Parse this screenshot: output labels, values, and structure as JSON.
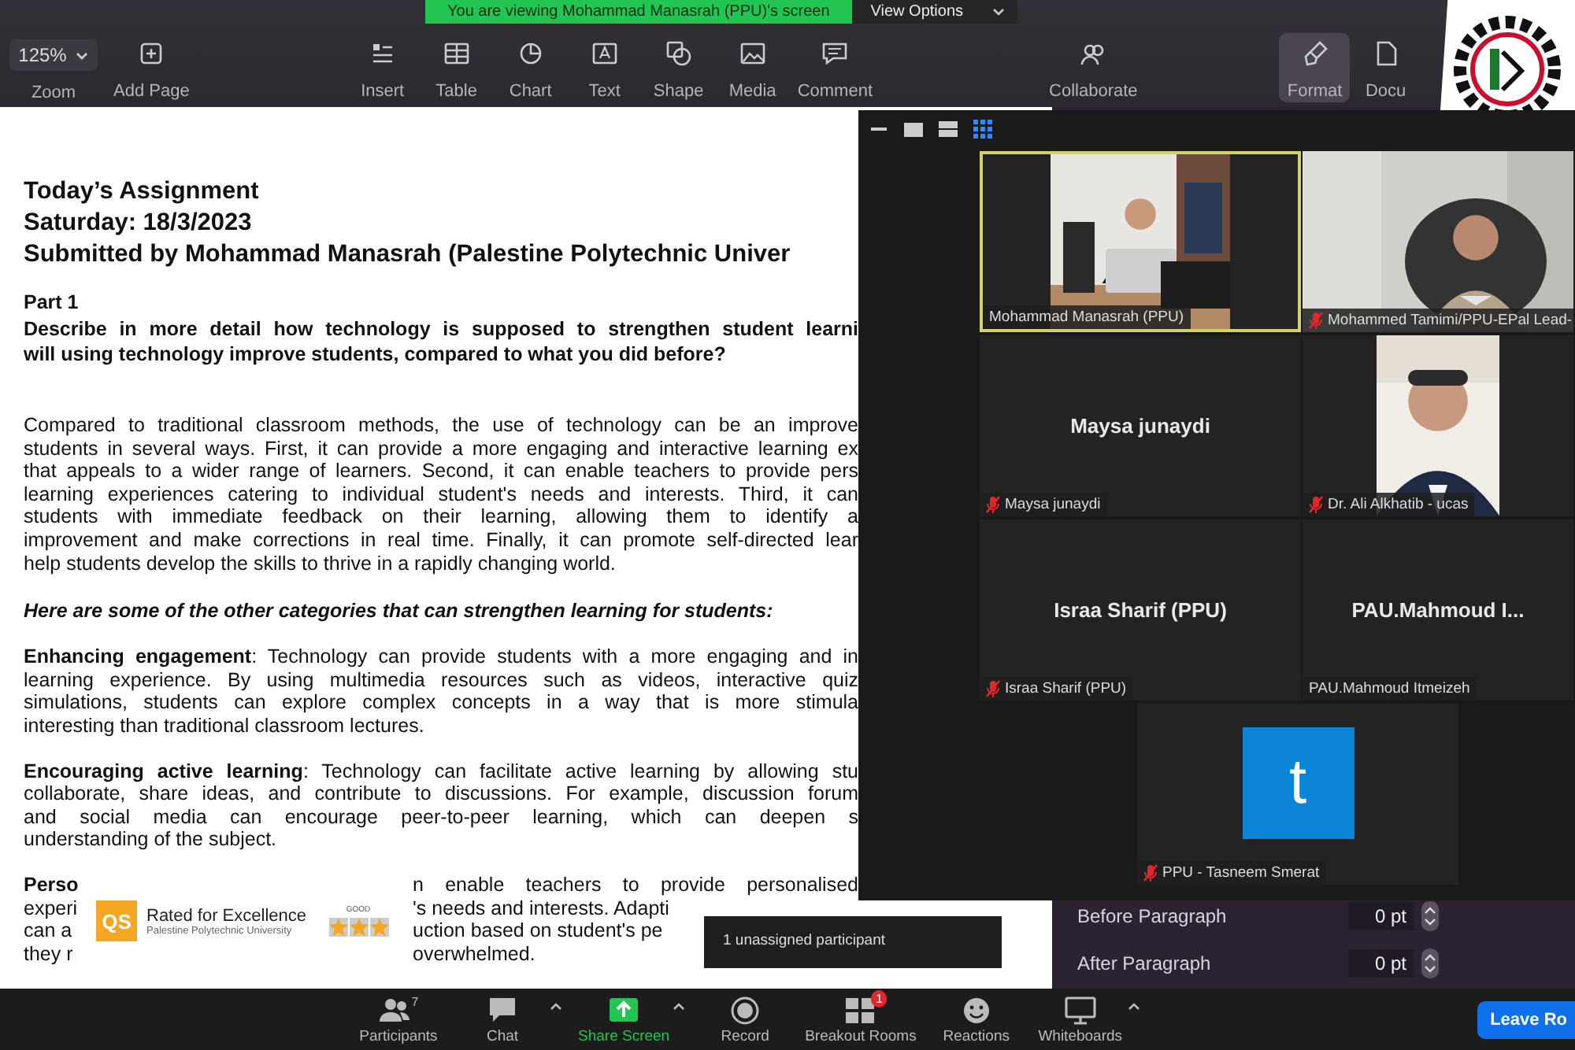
{
  "banner": {
    "message": "You are viewing Mohammad Manasrah (PPU)'s screen",
    "options": "View Options"
  },
  "toolbar": {
    "zoom": {
      "value": "125%",
      "label": "Zoom"
    },
    "groups": [
      [
        {
          "label": "Add Page",
          "selected": false
        }
      ],
      [
        {
          "label": "Insert",
          "selected": false
        },
        {
          "label": "Table",
          "selected": false
        },
        {
          "label": "Chart",
          "selected": false
        },
        {
          "label": "Text",
          "selected": false
        },
        {
          "label": "Shape",
          "selected": false
        },
        {
          "label": "Media",
          "selected": false
        },
        {
          "label": "Comment",
          "selected": false
        }
      ],
      [
        {
          "label": "Collaborate",
          "selected": false
        }
      ],
      [
        {
          "label": "Format",
          "selected": true
        },
        {
          "label": "Docu",
          "selected": false
        }
      ]
    ]
  },
  "document": {
    "blocks": [
      {
        "kind": "title",
        "lines": [
          "Today’s Assignment",
          "Saturday: 18/3/2023",
          "Submitted by Mohammad Manasrah (Palestine Polytechnic Univer"
        ]
      },
      {
        "kind": "part",
        "lines": [
          "Part 1"
        ]
      },
      {
        "kind": "question",
        "lines": [
          {
            "text": "Describe in more detail how technology is supposed to strengthen student learni",
            "justified": true
          },
          {
            "text": "will using technology improve students, compared to what you did before?",
            "justified": false
          }
        ]
      },
      {
        "kind": "paragraph",
        "lines": [
          {
            "text": "Compared to traditional classroom methods, the use of technology can be an improve",
            "justified": true
          },
          {
            "text": "students in several ways. First, it can provide a more engaging and interactive learning ex",
            "justified": true
          },
          {
            "text": "that appeals to a wider range of learners. Second, it can enable teachers to provide pers",
            "justified": true
          },
          {
            "text": "learning experiences catering to individual student's needs and interests. Third, it can",
            "justified": true
          },
          {
            "text": "students with immediate feedback on their learning, allowing them to identify a",
            "justified": true
          },
          {
            "text": "improvement and make corrections in real time. Finally, it can promote self-directed lear",
            "justified": true
          },
          {
            "text": "help students develop the skills to thrive in a rapidly changing world.",
            "justified": false
          }
        ]
      },
      {
        "kind": "lead",
        "lines": [
          "Here are some of the other categories that can strengthen learning for students:"
        ]
      },
      {
        "kind": "paragraph",
        "lines": [
          {
            "text": "**Enhancing engagement**: Technology can provide students with a more engaging and in",
            "justified": true
          },
          {
            "text": "learning experience. By using multimedia resources such as videos, interactive quiz",
            "justified": true
          },
          {
            "text": "simulations, students can explore complex concepts in a way that is more stimula",
            "justified": true
          },
          {
            "text": "interesting than traditional classroom lectures.",
            "justified": false
          }
        ]
      },
      {
        "kind": "paragraph",
        "lines": [
          {
            "text": "**Encouraging active learning**: Technology can facilitate active learning by allowing stu",
            "justified": true
          },
          {
            "text": "collaborate, share ideas, and contribute to discussions. For example, discussion forum",
            "justified": true
          },
          {
            "text": "and social media can encourage peer-to-peer learning, which can deepen s",
            "justified": true
          },
          {
            "text": "understanding of the subject.",
            "justified": false
          }
        ]
      },
      {
        "kind": "split",
        "lines": [
          {
            "left": "**Perso**",
            "right": "n enable teachers to provide personalised",
            "justified": true
          },
          {
            "left": "experi",
            "right": "'s needs and interests. Adapti",
            "justified": false
          },
          {
            "left": "can a",
            "right": "uction based on student's pe",
            "justified": false
          },
          {
            "left": "they r",
            "right": "overwhelmed.",
            "justified": false
          }
        ]
      }
    ]
  },
  "badge": {
    "logo": "QS",
    "title": "Rated for Excellence",
    "subtitle": "Palestine Polytechnic University",
    "rating_label": "GOOD",
    "stars": 3
  },
  "gallery": {
    "views": [
      {
        "selected": false
      },
      {
        "selected": false
      },
      {
        "selected": false
      },
      {
        "selected": true
      }
    ],
    "tiles": [
      {
        "kind": "video",
        "label": "Mohammad Manasrah (PPU)",
        "muted": false,
        "selected": true
      },
      {
        "kind": "video",
        "label": "Mohammed Tamimi/PPU-EPal Lead-",
        "muted": true,
        "selected": false
      },
      {
        "kind": "name",
        "name": "Maysa junaydi",
        "label": "Maysa junaydi",
        "muted": true,
        "selected": false
      },
      {
        "kind": "video",
        "label": "Dr. Ali Alkhatib  - ucas",
        "muted": true,
        "selected": false
      },
      {
        "kind": "name",
        "name": "Israa Sharif (PPU)",
        "label": "Israa Sharif (PPU)",
        "muted": true,
        "selected": false
      },
      {
        "kind": "name",
        "name": "PAU.Mahmoud  I...",
        "label": "PAU.Mahmoud Itmeizeh",
        "muted": false,
        "selected": false
      },
      {
        "kind": "avatar",
        "initial": "t",
        "color": "#0a84d6",
        "label": "PPU - Tasneem Smerat",
        "muted": true,
        "selected": false
      }
    ]
  },
  "format_panel": {
    "rows": [
      {
        "label": "Before Paragraph",
        "value": "0 pt"
      },
      {
        "label": "After Paragraph",
        "value": "0 pt"
      }
    ]
  },
  "tooltip": {
    "text": "1 unassigned participant"
  },
  "meeting_bar": {
    "items": [
      {
        "label": "Participants",
        "count": "7",
        "caret": false
      },
      {
        "label": "Chat",
        "caret": true
      },
      {
        "label": "Share Screen",
        "caret": true
      },
      {
        "label": "Record",
        "caret": false
      },
      {
        "label": "Breakout Rooms",
        "badge": "1",
        "caret": false
      },
      {
        "label": "Reactions",
        "caret": false
      },
      {
        "label": "Whiteboards",
        "caret": true
      }
    ],
    "leave": "Leave Ro"
  }
}
